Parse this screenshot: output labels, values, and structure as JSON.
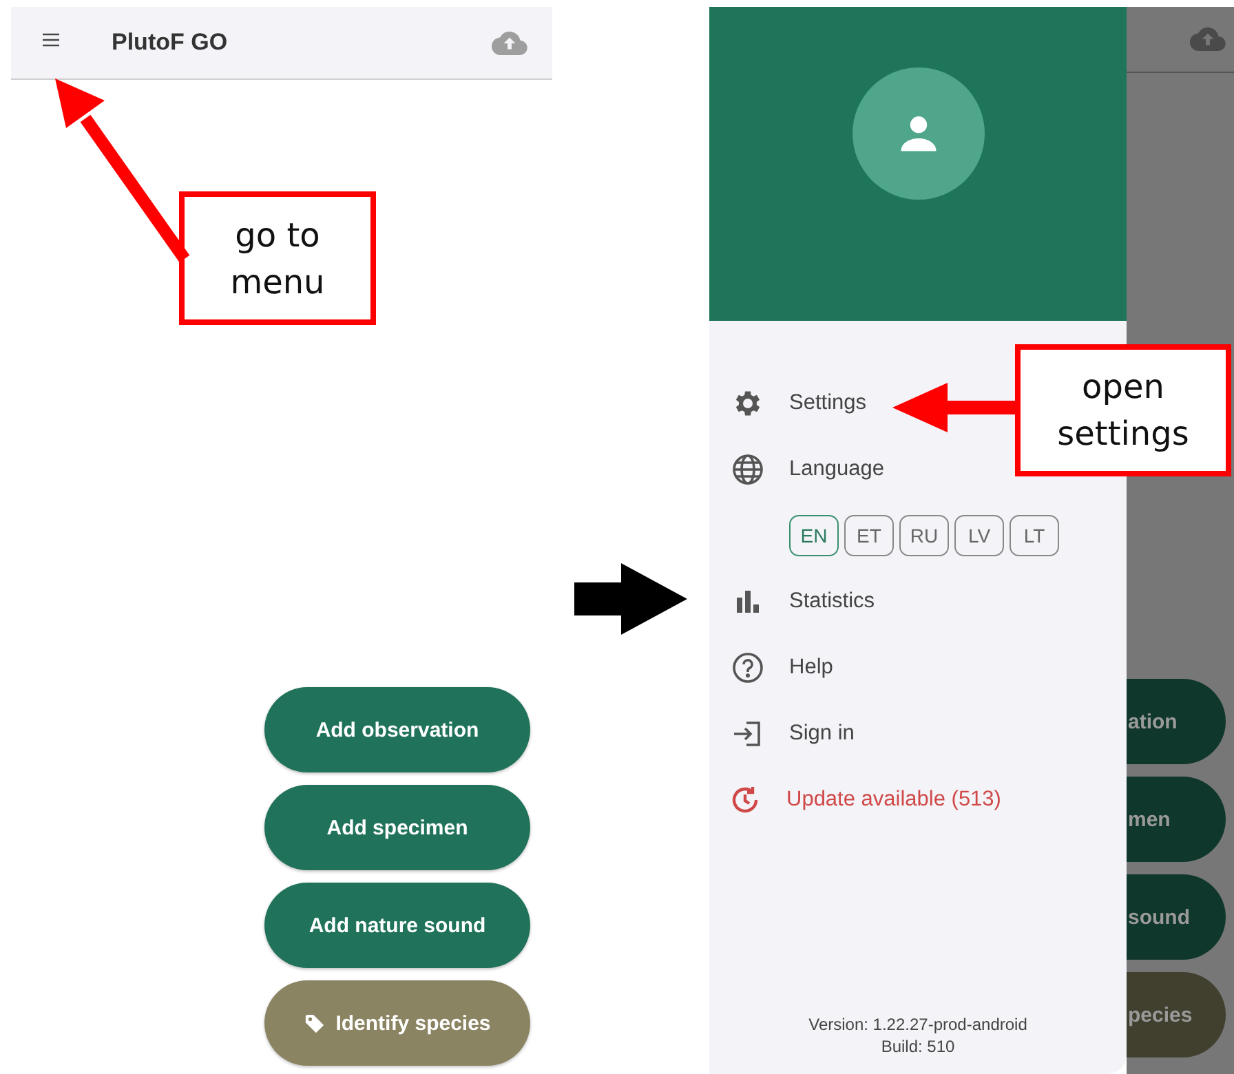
{
  "left_screen": {
    "app_bar": {
      "title": "PlutoF GO"
    },
    "actions": [
      {
        "label": "Add observation",
        "kind": "primary"
      },
      {
        "label": "Add specimen",
        "kind": "primary"
      },
      {
        "label": "Add nature sound",
        "kind": "primary"
      },
      {
        "label": "Identify species",
        "kind": "secondary"
      }
    ]
  },
  "right_screen": {
    "drawer": {
      "items": [
        {
          "label": "Settings",
          "kind": "settings"
        },
        {
          "label": "Language",
          "kind": "language",
          "options": [
            {
              "label": "EN",
              "selected": true
            },
            {
              "label": "ET",
              "selected": false
            },
            {
              "label": "RU",
              "selected": false
            },
            {
              "label": "LV",
              "selected": false
            },
            {
              "label": "LT",
              "selected": false
            }
          ]
        },
        {
          "label": "Statistics",
          "kind": "statistics"
        },
        {
          "label": "Help",
          "kind": "help"
        },
        {
          "label": "Sign in",
          "kind": "sign_in"
        },
        {
          "label": "Update available (513)",
          "kind": "update"
        }
      ],
      "version": "Version: 1.22.27-prod-android",
      "build": "Build: 510"
    },
    "background_actions": [
      {
        "label": "ation",
        "kind": "primary"
      },
      {
        "label": "men",
        "kind": "primary"
      },
      {
        "label": "sound",
        "kind": "primary"
      },
      {
        "label": "pecies",
        "kind": "secondary"
      }
    ]
  },
  "annotations": [
    {
      "text": "go to\nmenu"
    },
    {
      "text": "open\nsettings"
    }
  ]
}
